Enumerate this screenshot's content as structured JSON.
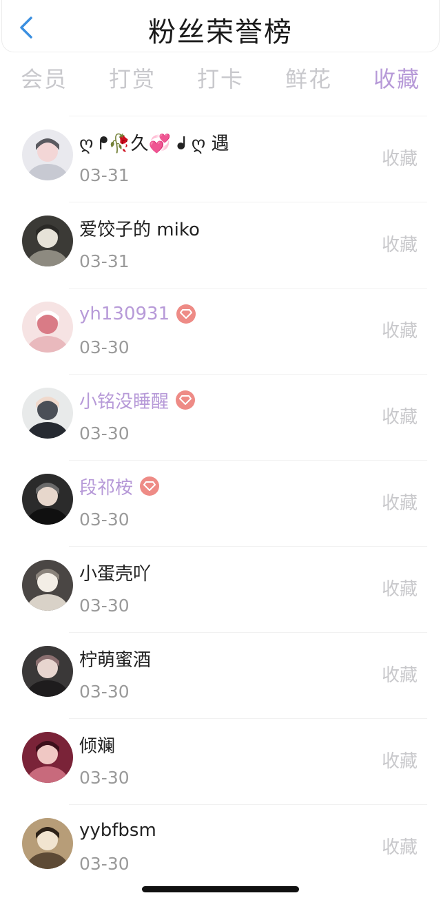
{
  "header": {
    "title": "粉丝荣誉榜",
    "back_icon": "chevron-left-icon",
    "accent_color": "#3b8fe0"
  },
  "tabs": [
    {
      "label": "会员",
      "active": false
    },
    {
      "label": "打赏",
      "active": false
    },
    {
      "label": "打卡",
      "active": false
    },
    {
      "label": "鲜花",
      "active": false
    },
    {
      "label": "收藏",
      "active": true
    }
  ],
  "colors": {
    "vip_name": "#b79ad8",
    "vip_badge": "#ee8b86",
    "active_tab": "#b79ad8"
  },
  "fans": [
    {
      "name": "ღ ᖰ🥀久💞 ᖱ ღ 遇",
      "date": "03-31",
      "vip": false,
      "action": "收藏",
      "avatar": "avatar-1"
    },
    {
      "name": "爱饺子的 miko",
      "date": "03-31",
      "vip": false,
      "action": "收藏",
      "avatar": "avatar-2"
    },
    {
      "name": "yh130931",
      "date": "03-30",
      "vip": true,
      "action": "收藏",
      "avatar": "avatar-3"
    },
    {
      "name": "小铭没睡醒",
      "date": "03-30",
      "vip": true,
      "action": "收藏",
      "avatar": "avatar-4"
    },
    {
      "name": "段祁桉",
      "date": "03-30",
      "vip": true,
      "action": "收藏",
      "avatar": "avatar-5"
    },
    {
      "name": "小蛋壳吖",
      "date": "03-30",
      "vip": false,
      "action": "收藏",
      "avatar": "avatar-6"
    },
    {
      "name": "柠萌蜜酒",
      "date": "03-30",
      "vip": false,
      "action": "收藏",
      "avatar": "avatar-7"
    },
    {
      "name": "倾斓",
      "date": "03-30",
      "vip": false,
      "action": "收藏",
      "avatar": "avatar-8"
    },
    {
      "name": "yybfbsm",
      "date": "03-30",
      "vip": false,
      "action": "收藏",
      "avatar": "avatar-9"
    }
  ]
}
